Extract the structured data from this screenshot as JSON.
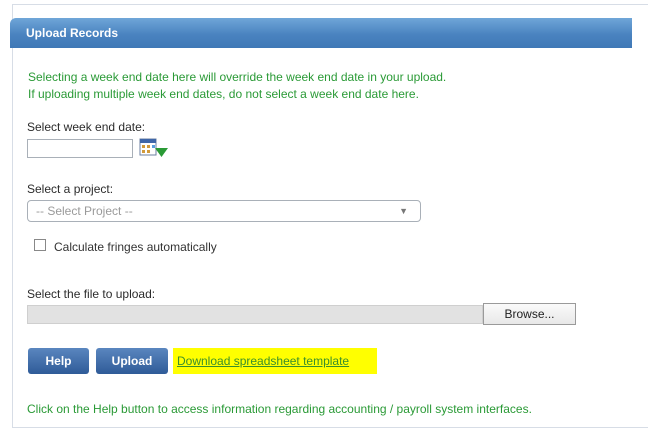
{
  "panel": {
    "title": "Upload Records",
    "intro_line1": "Selecting a week end date here will override the week end date in your upload.",
    "intro_line2": "If uploading multiple week end dates, do not select a week end date here."
  },
  "week_end": {
    "label": "Select week end date:",
    "value": "",
    "icon": "calendar-icon"
  },
  "project": {
    "label": "Select a project:",
    "selected": "-- Select Project --",
    "icon": "chevron-down-icon"
  },
  "fringes": {
    "label": "Calculate fringes automatically",
    "checked": false
  },
  "file": {
    "label": "Select the file to upload:",
    "value": "",
    "browse_label": "Browse..."
  },
  "actions": {
    "help_label": "Help",
    "upload_label": "Upload",
    "download_label": "Download spreadsheet template"
  },
  "footer": {
    "help_text": "Click on the Help button to access information regarding accounting / payroll system interfaces."
  },
  "colors": {
    "header": "#4a83c0",
    "green_text": "#2a9a36",
    "button": "#2f5b98",
    "highlight": "#ffff00"
  }
}
